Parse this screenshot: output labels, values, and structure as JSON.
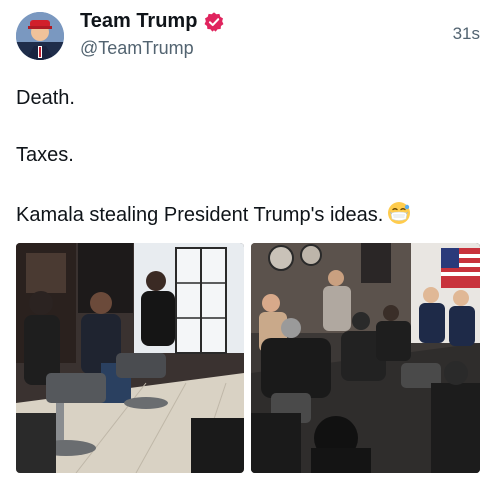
{
  "author": {
    "display_name": "Team Trump",
    "handle": "@TeamTrump",
    "avatar_icon": "avatar-photo",
    "verified_icon": "verified-badge-icon",
    "verified_color": "#e0245e"
  },
  "tweet": {
    "timestamp": "31s",
    "lines": [
      "Death.",
      "Taxes.",
      "Kamala stealing President Trump's ideas."
    ],
    "emoji_icon": "face-with-medical-mask-emoji"
  },
  "media": {
    "photos": [
      {
        "icon": "barbershop-photo-1"
      },
      {
        "icon": "barbershop-photo-2"
      }
    ]
  }
}
